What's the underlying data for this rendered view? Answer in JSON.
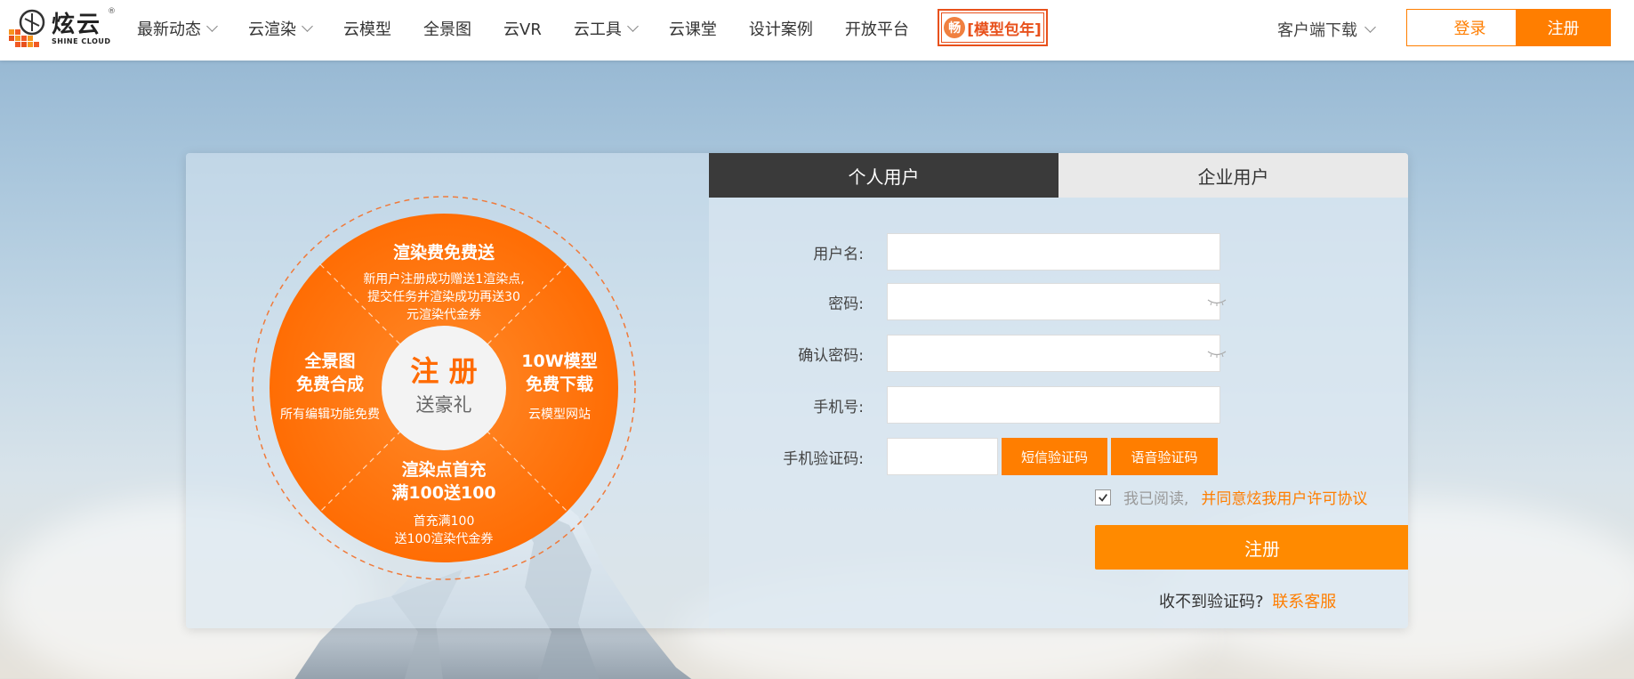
{
  "header": {
    "logo_cn": "炫云",
    "logo_en": "SHINE CLOUD",
    "logo_reg": "®",
    "nav": [
      {
        "label": "最新动态",
        "dropdown": true
      },
      {
        "label": "云渲染",
        "dropdown": true
      },
      {
        "label": "云模型",
        "dropdown": false
      },
      {
        "label": "全景图",
        "dropdown": false
      },
      {
        "label": "云VR",
        "dropdown": false
      },
      {
        "label": "云工具",
        "dropdown": true
      },
      {
        "label": "云课堂",
        "dropdown": false
      },
      {
        "label": "设计案例",
        "dropdown": false
      },
      {
        "label": "开放平台",
        "dropdown": false
      }
    ],
    "promo_badge_char": "畅",
    "promo_badge_text": "[模型包年]",
    "client_download": "客户端下载",
    "login": "登录",
    "register": "注册"
  },
  "promo": {
    "center_title": "注 册",
    "center_sub": "送豪礼",
    "top_title": "渲染费免费送",
    "top_desc_1": "新用户注册成功赠送1渲染点,",
    "top_desc_2": "提交任务并渲染成功再送30",
    "top_desc_3": "元渲染代金券",
    "left_title_1": "全景图",
    "left_title_2": "免费合成",
    "left_desc": "所有编辑功能免费",
    "right_title_1": "10W模型",
    "right_title_2": "免费下载",
    "right_desc": "云模型网站",
    "bottom_title_1": "渲染点首充",
    "bottom_title_2": "满100送100",
    "bottom_desc_1": "首充满100",
    "bottom_desc_2": "送100渲染代金券"
  },
  "form": {
    "tab_personal": "个人用户",
    "tab_enterprise": "企业用户",
    "username_label": "用户名:",
    "password_label": "密码:",
    "confirm_label": "确认密码:",
    "phone_label": "手机号:",
    "code_label": "手机验证码:",
    "sms_button": "短信验证码",
    "voice_button": "语音验证码",
    "agree_prefix": "我已阅读,",
    "agree_link": "并同意炫我用户许可协议",
    "agree_checked": true,
    "submit": "注册",
    "help_text": "收不到验证码?",
    "help_link": "联系客服"
  },
  "colors": {
    "accent": "#ff7e00",
    "promo_red": "#e8511c",
    "tab_dark": "#3a3a3a"
  }
}
